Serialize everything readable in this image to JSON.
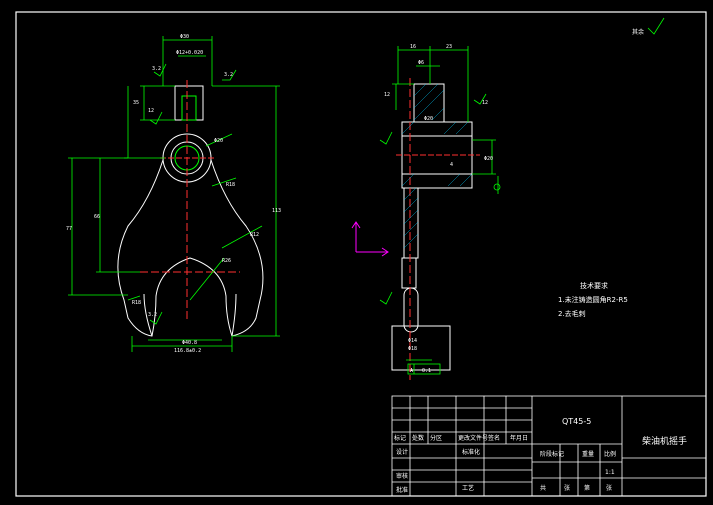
{
  "drawing": {
    "part_title": "柴油机摇手",
    "material": "QT45-5",
    "scale": "1:1",
    "roughness_other": "其余"
  },
  "tech_requirements": {
    "heading": "技术要求",
    "items": [
      "1.未注铸造圆角R2-R5",
      "2.去毛刺"
    ]
  },
  "title_block": {
    "labels": [
      "标记",
      "处数",
      "分区",
      "更改文件号",
      "签名",
      "年月日",
      "设计",
      "标准化",
      "审核",
      "工艺",
      "批准",
      "阶段标记",
      "重量",
      "比例",
      "共",
      "张",
      "第",
      "张"
    ]
  },
  "dimensions": {
    "top_width": "Φ30",
    "slot": "Φ12+0.020",
    "roughness_a": "3.2",
    "roughness_b": "3.2",
    "roughness_c": "3.2",
    "height_1": "35",
    "height_2": "12",
    "left_total": "77",
    "left_mid": "66",
    "bore": "Φ20",
    "radius_1": "R18",
    "radius_2": "R12",
    "radius_3": "R26",
    "overall": "113",
    "bottom_1": "R18",
    "bottom_2": "Φ40.8",
    "bottom_3": "116.8±0.2",
    "side_top_1": "16",
    "side_top_2": "23",
    "side_r1": "Φ6",
    "side_r2": "12",
    "side_mid": "Φ20",
    "side_angle": "12",
    "side_d": "Φ20",
    "side_lower": "4",
    "side_bottom_1": "Φ14",
    "side_bottom_2": "Φ18",
    "tol_box": "0.1",
    "datum": "A"
  }
}
